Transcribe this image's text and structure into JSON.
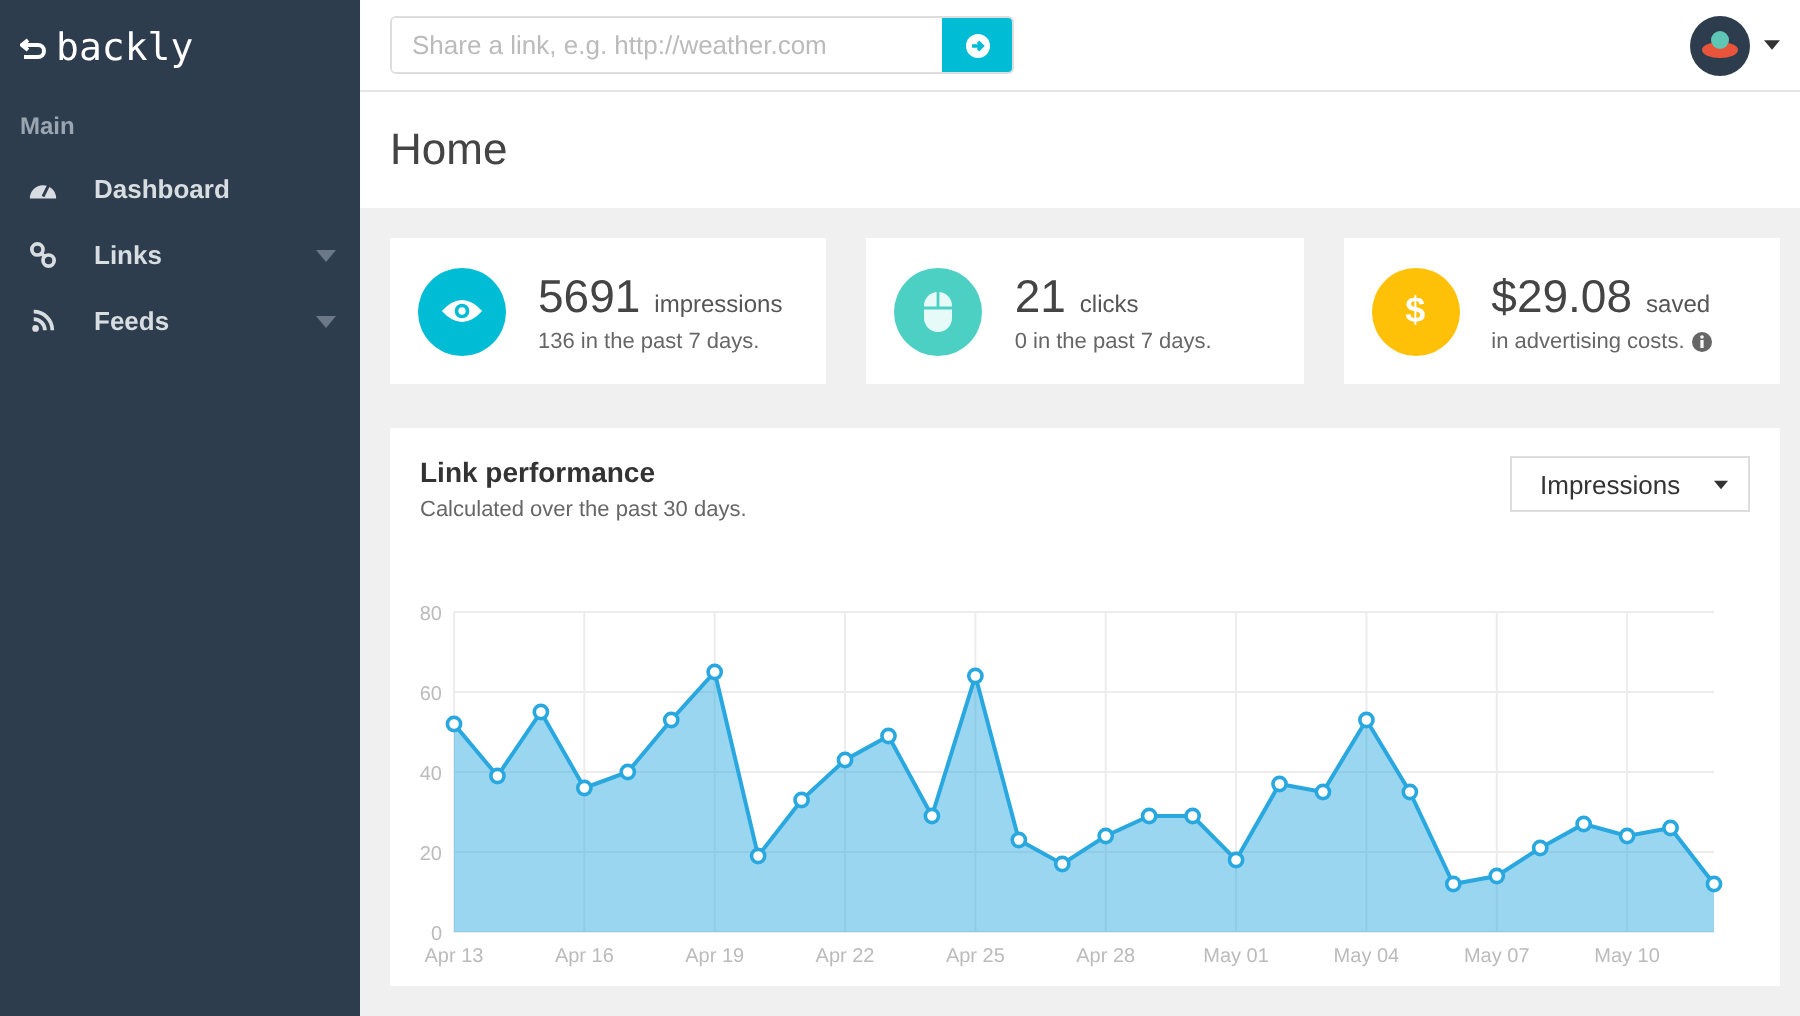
{
  "sidebar": {
    "logo": "backly",
    "section": "Main",
    "items": [
      {
        "label": "Dashboard",
        "kind": "dashboard",
        "has_submenu": false
      },
      {
        "label": "Links",
        "kind": "links",
        "has_submenu": true
      },
      {
        "label": "Feeds",
        "kind": "feeds",
        "has_submenu": true
      }
    ]
  },
  "topbar": {
    "share": {
      "placeholder": "Share a link, e.g. http://weather.com"
    }
  },
  "page_title": "Home",
  "stats": [
    {
      "kind": "eye",
      "color": "#00bcd4",
      "value": "5691",
      "unit": "impressions",
      "note": "136 in the past 7 days.",
      "info": false
    },
    {
      "kind": "mouse",
      "color": "#4dd0c4",
      "value": "21",
      "unit": "clicks",
      "note": "0 in the past 7 days.",
      "info": false
    },
    {
      "kind": "dollar",
      "glyph": "$",
      "color": "#ffc107",
      "value": "$29.08",
      "unit": "saved",
      "note": "in advertising costs.",
      "info": true
    }
  ],
  "performance": {
    "title": "Link performance",
    "subtitle": "Calculated over the past 30 days.",
    "metric": "Impressions",
    "chart_data": {
      "type": "area",
      "categories": [
        "Apr 13",
        null,
        null,
        "Apr 16",
        null,
        null,
        "Apr 19",
        null,
        null,
        "Apr 22",
        null,
        null,
        "Apr 25",
        null,
        null,
        "Apr 28",
        null,
        null,
        "May 01",
        null,
        null,
        "May 04",
        null,
        null,
        "May 07",
        null,
        null,
        "May 10",
        null,
        null
      ],
      "series": [
        {
          "color": "#29a8e0",
          "values": [
            52,
            39,
            55,
            36,
            40,
            53,
            65,
            19,
            33,
            43,
            49,
            29,
            64,
            23,
            17,
            24,
            29,
            29,
            18,
            37,
            35,
            53,
            35,
            12,
            14,
            21,
            27,
            24,
            26,
            12
          ]
        }
      ],
      "ylim": [
        0,
        80
      ],
      "yticks": [
        0,
        20,
        40,
        60,
        80
      ],
      "grid": true
    }
  }
}
